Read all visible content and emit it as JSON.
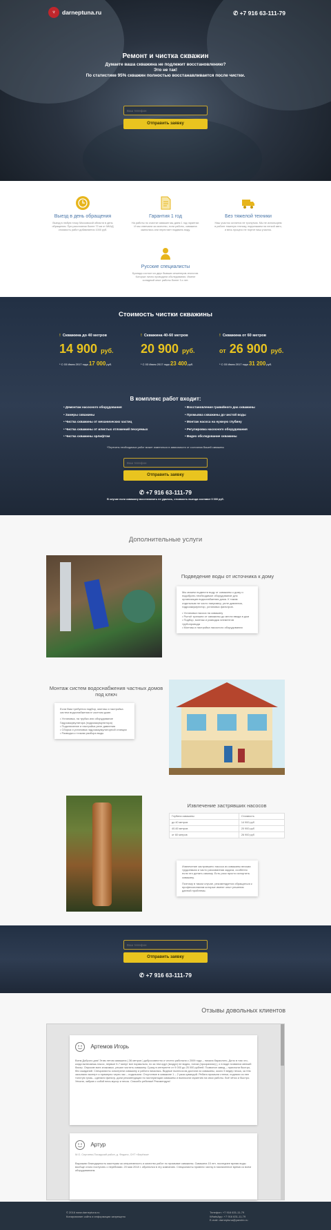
{
  "header": {
    "logo_text": "darneptuna.ru",
    "phone": "+7 916 63-111-79"
  },
  "hero": {
    "title": "Ремонт и чистка скважин",
    "subtitle1": "Думаете ваша скважина не подлежит восстановлению?",
    "subtitle2": "Это не так!",
    "subtitle3": "По статистике 95% скважин полностью восстанавливается после чистки.",
    "phone_placeholder": "Ваш телефон",
    "submit_label": "Отправить заявку"
  },
  "features": [
    {
      "icon": "clock-icon",
      "title": "Выезд в день обращения",
      "desc": "Выезд в любую точку Московской области в день обращения. При расстоянии более 70 км от МКАД стоимость работ добавляется 1000 руб."
    },
    {
      "icon": "document-icon",
      "title": "Гарантия 1 год",
      "desc": "На работы по очистке скважин мы даем 1 год гарантии. И мы отвечаем за качество, если работы, скважина заилилась или перестает подавать воду."
    },
    {
      "icon": "truck-icon",
      "title": "Без тяжелой техники",
      "desc": "Наш участок остается не тронутым. Мы не используем в работе тяжелую технику, подъезжаем на легкой авто, и весь процесс не портит ваш участок."
    },
    {
      "icon": "worker-icon",
      "title": "Русские специалисты",
      "desc": "Бригада состоит из двух бывших инженеров-геологов. Которые лично проводили обследования. Имеют солидный опыт работы более 3-х лет."
    }
  ],
  "pricing": {
    "title": "Стоимость чистки скважины",
    "plans": [
      {
        "name": "Скважина до 40 метров",
        "price": "14 900",
        "prefix": "",
        "currency": "руб.",
        "old_note": "* С 03 Июля 2017 года",
        "old_price": "17 000",
        "old_cur": "руб."
      },
      {
        "name": "Скважина 40-60 метров",
        "price": "20 900",
        "prefix": "",
        "currency": "руб.",
        "old_note": "* С 03 Июля 2017 года",
        "old_price": "23 400",
        "old_cur": "руб."
      },
      {
        "name": "Скважина от 60 метров",
        "price": "26 900",
        "prefix": "от",
        "currency": "руб.",
        "old_note": "* С 03 Июля 2017 года",
        "old_price": "31 200",
        "old_cur": "руб."
      }
    ],
    "includes_title": "В комплекс работ входит:",
    "includes_left": [
      "Демонтаж насосного оборудования",
      "Замеры скважины",
      "Чистка скважины от механических частиц",
      "Чистка скважины от илистых отложений пескуемых",
      "Чистка скважины эрлифтом"
    ],
    "includes_right": [
      "Восстановление гравийного дна скважины",
      "Промывка скважины до чистой воды",
      "Монтаж насоса на нужную глубину",
      "Регулировка насосного оборудования",
      "Видео обследование скважины"
    ],
    "note": "*Перечень необходимых работ может изменяться в зависимости от состояния Вашей скважины",
    "phone_placeholder": "Ваш телефон",
    "submit_label": "Отправить заявку",
    "phone": "+7 916 63-111-79",
    "guarantee": "В случае если скважину восстановить не удалось, стоимость выезда составит 0 000 руб."
  },
  "services": {
    "title": "Дополнительные услуги",
    "s1": {
      "heading": "Подведение воды от источника к дому",
      "text": "Мы можем подвести воду от скважины к дому и подобрать необходимое оборудование для организации водоснабжения дома. К таким отдельным не часто например, реле давления, гидроаккумулятор, установка фильтров.",
      "items": [
        "Установка насоса на скважину",
        "Рытьё траншеи от скважины до места ввода в дом",
        "Подбор, монтаж и разводка элементов трубопровода",
        "Монтаж и настройка насосного оборудования"
      ]
    },
    "s2": {
      "heading": "Монтаж систем водоснабжения частных домов под ключ",
      "text": "Если Вам требуется подбор, монтаж и настройка систем водоснабжения в частном доме.",
      "items": [
        "Установка, на трубка или оборудование Гидроаккумулятора (гидроаккумулятора)",
        "Подключение и настройка реле давления",
        "Сборка и установка гидроаккумуляторной станции",
        "Разводка к точкам разбора воды"
      ]
    },
    "s3": {
      "heading": "Извлечение застрявших насосов",
      "table_headers": [
        "Глубина скважины",
        "Стоимость"
      ],
      "table_rows": [
        [
          "до 40 метров",
          "14 900 руб"
        ],
        [
          "40-60 метров",
          "20 900 руб"
        ],
        [
          "от 60 метров",
          "26 900 руб"
        ]
      ],
      "text1": "Извлечение застрявшего насоса из скважины весьма трудоемкая и часто рискованная задача, особенно если это делать самому. Есть риск просто испортить скважину.",
      "text2": "Поэтому в таком случае, рекомендуется обращаться к профессионалам которые имеют опыт решения данной проблемы."
    }
  },
  "cta": {
    "phone_placeholder": "Ваш телефон",
    "submit_label": "Отправить заявку",
    "phone": "+7 916 63-111-79"
  },
  "reviews": {
    "title": "Отзывы довольных клиентов",
    "items": [
      {
        "name": "Артемов Игорь",
        "meta": "",
        "text": "Всем Доброго дня! Этим летом скважина ( 36 метров ) добросовестно и честно работала с 2009 года – начала барахлить. Дело в том что, когда включаешь насос, первые 5-7 минут все нормально, но за тем идут (воздух) не видно, потом (прозрачная) ), и в воде появился мелкий бисер. Опросив всех знакомых, решил чистить скважину. Сразу в интернете от 9 000 до 25 000 рублей. Позвонил завод – прислали быстро, без ожиданий. Специалисты осмотрели скважину и работа началась. Видные пылесосом достали из скважины, около 5 ведер песка, за тем засыпали эксперт и примерно через час – подкачали. Отсутствие в скважине 1 – 2 раза кувалдой. Ребята промыли стенки, подняли из нее толстую грязь...сделали фильтр, дали рекомендации по эксплуатации скважины и выписали гарантию на свои работы. Всё чётко и быстро. Уехали, забрав с собой весь мусор и песок. Спасибо ребятам! Рекомендую!"
      },
      {
        "name": "Артур",
        "meta": "М.О. Сергиево-Посадский район, д. Федино, СНТ «Берёзка»",
        "text": "Выражаю благодарность мастерам за оперативность и качество работ по промывке скважины. Скважина 15 лет, последнее время воды вообще стало поступать с перебоями. 20 мая 2018 г. обратился в эту компанию. Специалисты провели чистку в назначенное время со всем оборудованием."
      }
    ]
  },
  "footer": {
    "left1": "© 2016 www.darneptuna.ru",
    "left2": "Копирование сайта и информации запрещено",
    "right1": "Телефон: +7 916 631-11-79",
    "right2": "WhatsApp: +7 916 631-11-79",
    "right3": "E-mail: darneptuna@yandex.ru"
  },
  "colors": {
    "accent": "#e9c41f",
    "dark": "#26323f",
    "link": "#4a76a8"
  }
}
